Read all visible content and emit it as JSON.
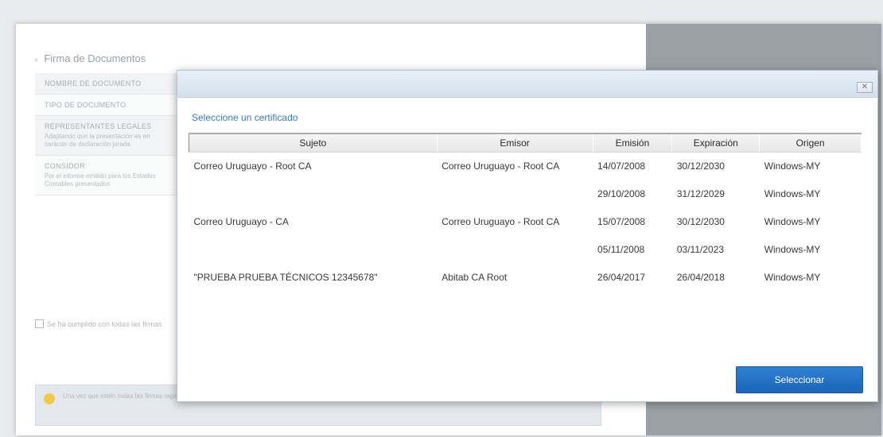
{
  "background_page": {
    "title": "Firma de Documentos",
    "form_rows": [
      {
        "label": "NOMBRE DE DOCUMENTO",
        "desc": ""
      },
      {
        "label": "TIPO DE DOCUMENTO",
        "desc": ""
      },
      {
        "label": "REPRESENTANTES LEGALES",
        "desc": "Adaptando que la presentación es en carácter de declaración jurada"
      },
      {
        "label": "CONSIDOR",
        "desc": "Por el informe emitido para los Estados Contables presentados"
      }
    ],
    "checkbox_label": "Se ha cumplido con todas las firmas",
    "info_text": "Una vez que estén todas las firmas registradas se notificará mediante correo electrónico y podrá consultar la misma mediante el RUT y el código de solicitud"
  },
  "dialog": {
    "close_label": "✕",
    "heading": "Seleccione un certificado",
    "columns": [
      "Sujeto",
      "Emisor",
      "Emisión",
      "Expiración",
      "Origen"
    ],
    "rows": [
      {
        "sujeto": "Correo Uruguayo - Root CA",
        "emisor": "Correo Uruguayo - Root CA",
        "emision": "14/07/2008",
        "expiracion": "30/12/2030",
        "origen": "Windows-MY"
      },
      {
        "sujeto": "",
        "emisor": "",
        "emision": "29/10/2008",
        "expiracion": "31/12/2029",
        "origen": "Windows-MY"
      },
      {
        "sujeto": "Correo Uruguayo - CA",
        "emisor": "Correo Uruguayo - Root CA",
        "emision": "15/07/2008",
        "expiracion": "30/12/2030",
        "origen": "Windows-MY"
      },
      {
        "sujeto": "",
        "emisor": "",
        "emision": "05/11/2008",
        "expiracion": "03/11/2023",
        "origen": "Windows-MY"
      },
      {
        "sujeto": "\"PRUEBA PRUEBA TÉCNICOS 12345678\"",
        "emisor": "Abitab CA Root",
        "emision": "26/04/2017",
        "expiracion": "26/04/2018",
        "origen": "Windows-MY"
      }
    ],
    "select_button": "Seleccionar"
  },
  "colors": {
    "accent": "#1f6fc2",
    "heading": "#3a7dc4"
  }
}
